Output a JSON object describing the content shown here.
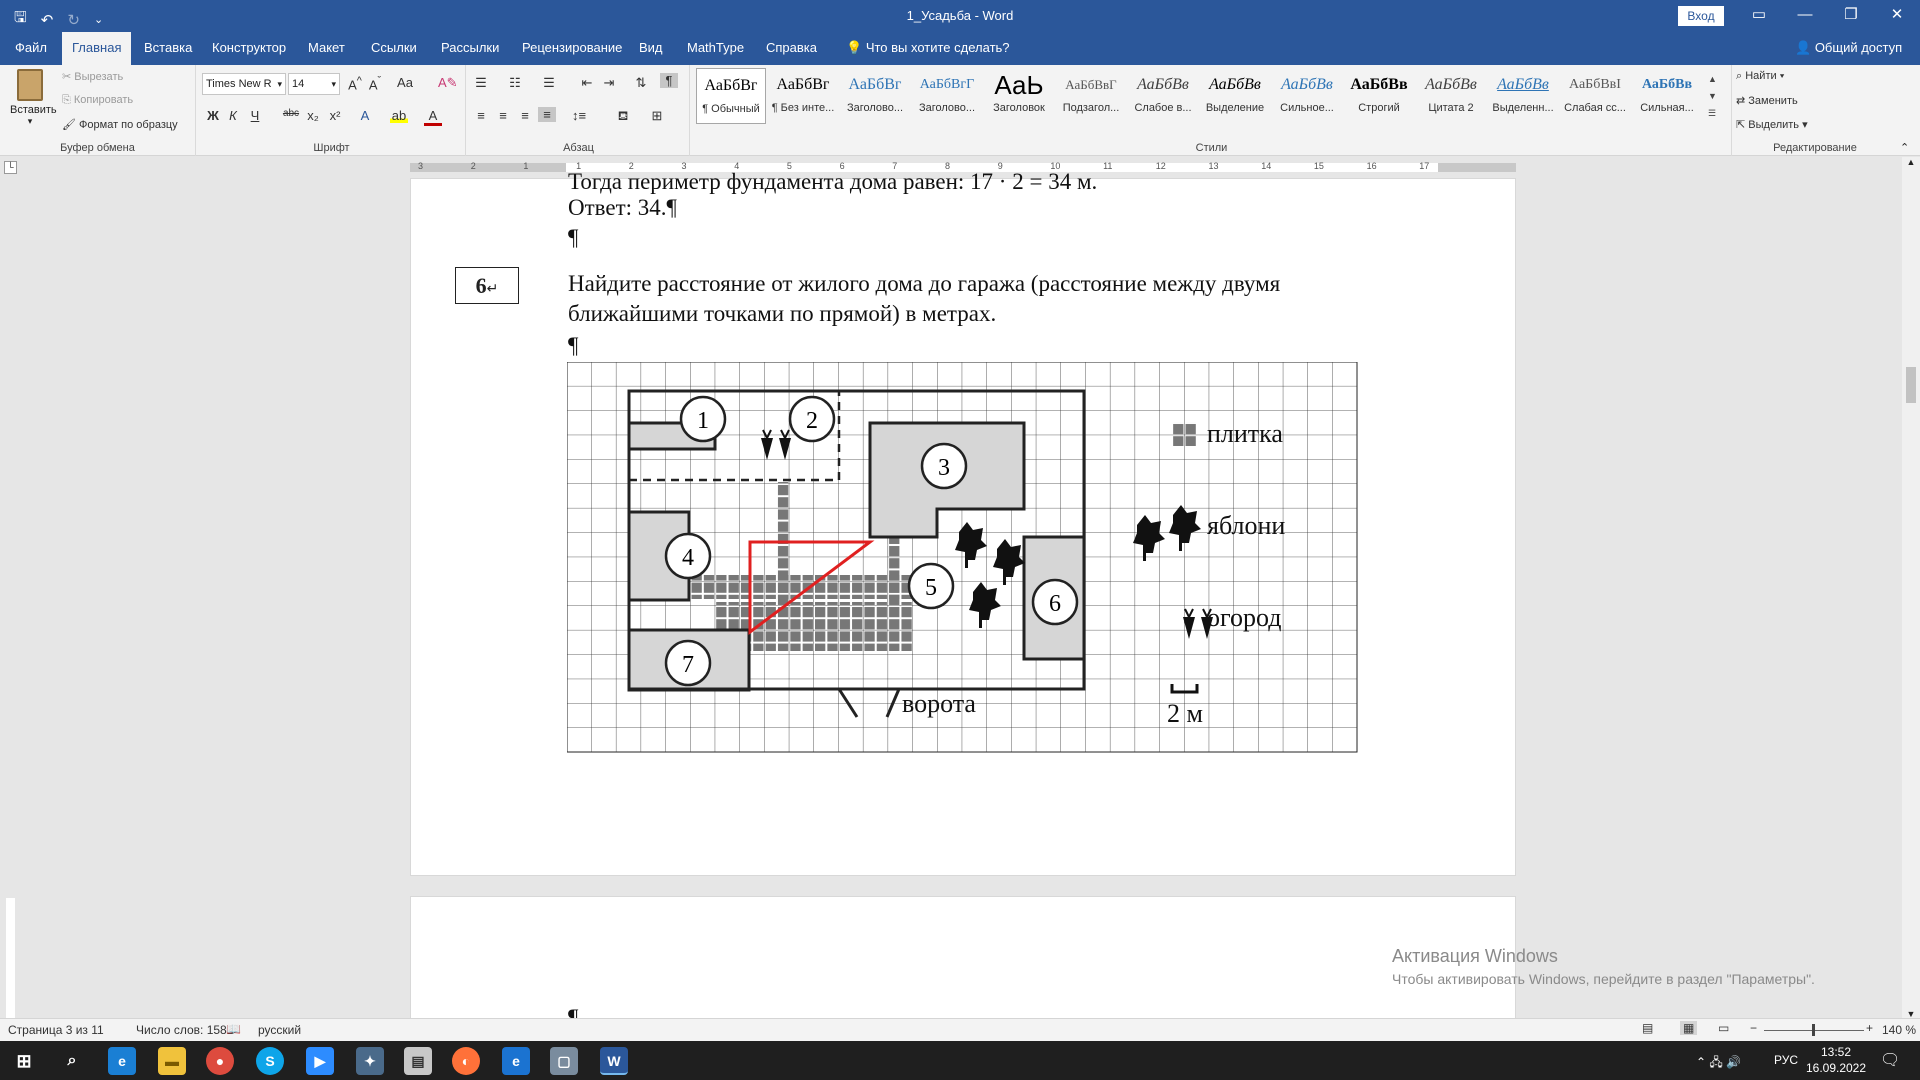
{
  "window": {
    "title": "1_Усадьба  -  Word",
    "signin": "Вход"
  },
  "tabs": [
    "Файл",
    "Главная",
    "Вставка",
    "Конструктор",
    "Макет",
    "Ссылки",
    "Рассылки",
    "Рецензирование",
    "Вид",
    "MathType",
    "Справка"
  ],
  "tell_me": "Что вы хотите сделать?",
  "share": "Общий доступ",
  "clipboard": {
    "paste": "Вставить",
    "cut": "Вырезать",
    "copy": "Копировать",
    "format_painter": "Формат по образцу",
    "label": "Буфер обмена"
  },
  "font": {
    "name": "Times New R",
    "size": "14",
    "label": "Шрифт"
  },
  "paragraph": {
    "label": "Абзац"
  },
  "styles": {
    "label": "Стили",
    "items": [
      {
        "preview": "АаБбВг",
        "name": "¶ Обычный",
        "color": "#000000"
      },
      {
        "preview": "АаБбВг",
        "name": "¶ Без инте...",
        "color": "#000000"
      },
      {
        "preview": "АаБбВг",
        "name": "Заголово...",
        "color": "#2e74b5"
      },
      {
        "preview": "АаБбВгГ",
        "name": "Заголово...",
        "color": "#2e74b5"
      },
      {
        "preview": "АаЬ",
        "name": "Заголовок",
        "color": "#000000"
      },
      {
        "preview": "АаБбВвГ",
        "name": "Подзагол...",
        "color": "#555555"
      },
      {
        "preview": "АаБбВв",
        "name": "Слабое в...",
        "color": "#404040"
      },
      {
        "preview": "АаБбВв",
        "name": "Выделение",
        "color": "#000000"
      },
      {
        "preview": "АаБбВв",
        "name": "Сильное...",
        "color": "#2e74b5"
      },
      {
        "preview": "АаБбВв",
        "name": "Строгий",
        "color": "#000000"
      },
      {
        "preview": "АаБбВв",
        "name": "Цитата 2",
        "color": "#404040"
      },
      {
        "preview": "АаБбВв",
        "name": "Выделенн...",
        "color": "#2e74b5"
      },
      {
        "preview": "АаБбВвI",
        "name": "Слабая сс...",
        "color": "#595959"
      },
      {
        "preview": "АаБбВв",
        "name": "Сильная...",
        "color": "#2e74b5"
      }
    ]
  },
  "editing": {
    "find": "Найти",
    "replace": "Заменить",
    "select": "Выделить",
    "label": "Редактирование"
  },
  "ruler": {
    "numbers": [
      "3",
      "2",
      "1",
      "1",
      "2",
      "3",
      "4",
      "5",
      "6",
      "7",
      "8",
      "9",
      "10",
      "11",
      "12",
      "13",
      "14",
      "15",
      "16",
      "17"
    ]
  },
  "document": {
    "partial_line": "Тогда периметр фундамента дома равен: 17 · 2 = 34 м.",
    "answer_line": "Ответ: 34.",
    "pilcrow": "¶",
    "task_number": "6",
    "task_line1": "Найдите расстояние от жилого дома до гаража (расстояние между двумя",
    "task_line2": "ближайшими точками по прямой) в метрах.",
    "figure": {
      "zones": [
        "1",
        "2",
        "3",
        "4",
        "5",
        "6",
        "7"
      ],
      "legend_tile": "плитка",
      "legend_apple": "яблони",
      "legend_garden": "огород",
      "scale": "2 м",
      "gate": "ворота"
    }
  },
  "activation": {
    "title": "Активация Windows",
    "subtitle": "Чтобы активировать Windows, перейдите в раздел \"Параметры\"."
  },
  "status": {
    "page": "Страница 3 из 11",
    "words": "Число слов: 1582",
    "language": "русский",
    "zoom": "140 %"
  },
  "taskbar": {
    "language": "РУС",
    "time": "13:52",
    "date": "16.09.2022"
  }
}
